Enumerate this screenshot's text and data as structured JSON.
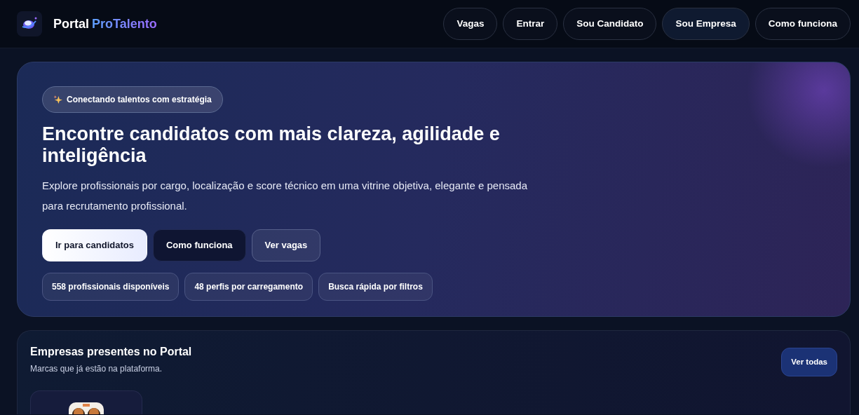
{
  "brand": {
    "first": "Portal",
    "second": "ProTalento"
  },
  "nav": [
    {
      "label": "Vagas",
      "kind": "dark"
    },
    {
      "label": "Entrar",
      "kind": "dark"
    },
    {
      "label": "Sou Candidato",
      "kind": "dark"
    },
    {
      "label": "Sou Empresa",
      "kind": "navy"
    },
    {
      "label": "Como funciona",
      "kind": "dark"
    }
  ],
  "hero": {
    "badge": "Conectando talentos com estratégia",
    "title": "Encontre candidatos com mais clareza, agilidade e inteligência",
    "lead": "Explore profissionais por cargo, localização e score técnico em uma vitrine objetiva, elegante e pensada para recrutamento profissional.",
    "buttons": [
      {
        "label": "Ir para candidatos",
        "kind": "light"
      },
      {
        "label": "Como funciona",
        "kind": "dark"
      },
      {
        "label": "Ver vagas",
        "kind": "glass"
      }
    ],
    "chips": [
      "558 profissionais disponíveis",
      "48 perfis por carregamento",
      "Busca rápida por filtros"
    ]
  },
  "companies": {
    "title": "Empresas presentes no Portal",
    "subtitle": "Marcas que já estão na plataforma.",
    "button": "Ver todas"
  }
}
